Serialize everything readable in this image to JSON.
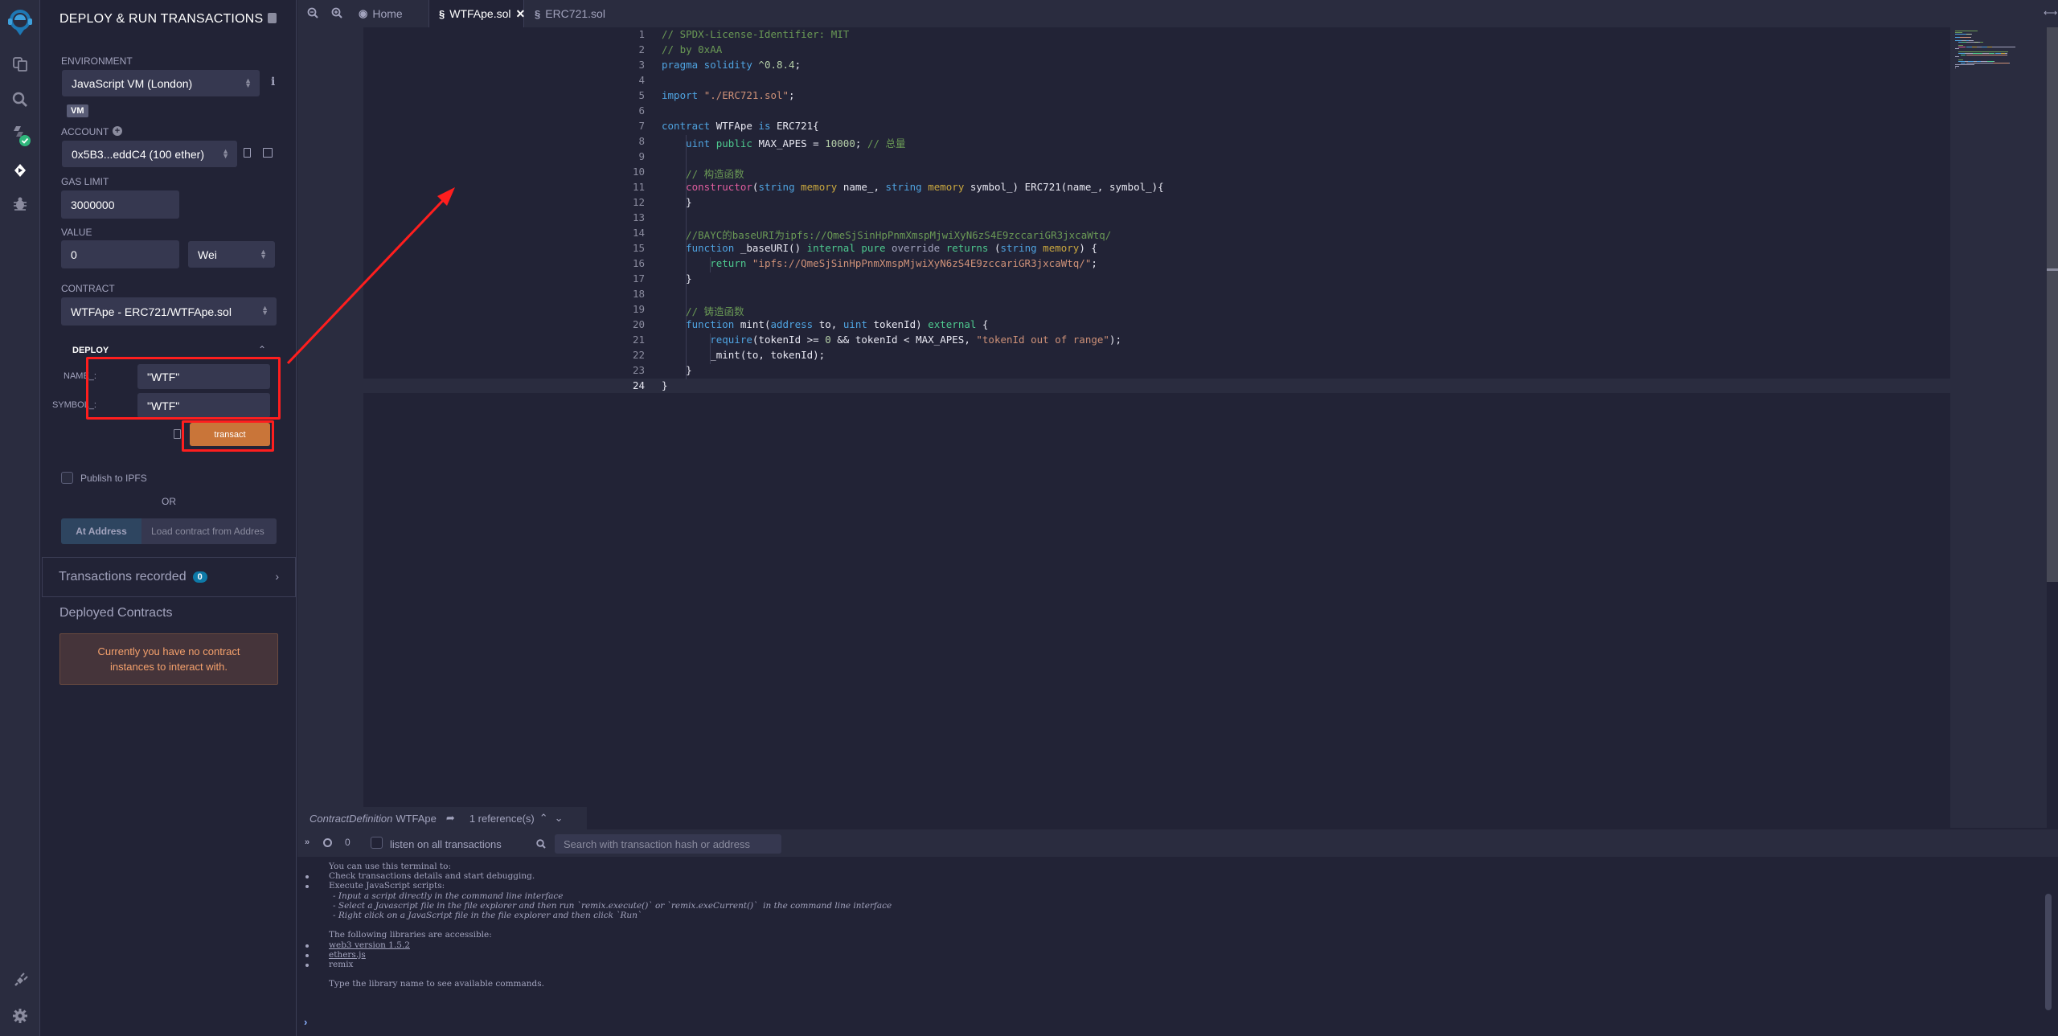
{
  "iconbar": {
    "items": [
      "remix-logo",
      "file-explorer",
      "search",
      "solidity-compiler",
      "deploy-run",
      "debugger"
    ],
    "bottom": [
      "plugin-manager",
      "settings"
    ]
  },
  "panel": {
    "title": "DEPLOY & RUN TRANSACTIONS",
    "environment_label": "ENVIRONMENT",
    "environment_value": "JavaScript VM (London)",
    "vm_badge": "VM",
    "account_label": "ACCOUNT",
    "account_value": "0x5B3...eddC4 (100 ether)",
    "gas_limit_label": "GAS LIMIT",
    "gas_limit_value": "3000000",
    "value_label": "VALUE",
    "value_value": "0",
    "value_unit": "Wei",
    "contract_label": "CONTRACT",
    "contract_value": "WTFApe - ERC721/WTFApe.sol",
    "deploy_label": "DEPLOY",
    "params": [
      {
        "label": "NAME_:",
        "value": "\"WTF\""
      },
      {
        "label": "SYMBOL_:",
        "value": "\"WTF\""
      }
    ],
    "transact_label": "transact",
    "publish_ipfs_label": "Publish to IPFS",
    "or_label": "OR",
    "at_address_label": "At Address",
    "load_contract_placeholder": "Load contract from Addres",
    "transactions_recorded_label": "Transactions recorded",
    "transactions_recorded_count": "0",
    "deployed_contracts_label": "Deployed Contracts",
    "no_contracts_message": "Currently you have no contract instances to interact with."
  },
  "editor": {
    "tabs": [
      {
        "label": "Home",
        "active": false
      },
      {
        "label": "WTFApe.sol",
        "active": true
      },
      {
        "label": "ERC721.sol",
        "active": false
      }
    ],
    "line_numbers": [
      "1",
      "2",
      "3",
      "4",
      "5",
      "6",
      "7",
      "8",
      "9",
      "10",
      "11",
      "12",
      "13",
      "14",
      "15",
      "16",
      "17",
      "18",
      "19",
      "20",
      "21",
      "22",
      "23",
      "24"
    ],
    "lines": [
      [
        [
          "c-cm",
          "// SPDX-License-Identifier: MIT"
        ]
      ],
      [
        [
          "c-cm",
          "// by 0xAA"
        ]
      ],
      [
        [
          "c-kw",
          "pragma solidity "
        ],
        [
          "c-nm",
          "^0.8.4"
        ],
        [
          "c-fn",
          ";"
        ]
      ],
      [],
      [
        [
          "c-kw",
          "import "
        ],
        [
          "c-st",
          "\"./ERC721.sol\""
        ],
        [
          "c-fn",
          ";"
        ]
      ],
      [],
      [
        [
          "c-kw",
          "contract "
        ],
        [
          "c-fn",
          "WTFApe "
        ],
        [
          "c-kw",
          "is "
        ],
        [
          "c-fn",
          "ERC721{"
        ]
      ],
      [
        [
          "c-fn",
          "    "
        ],
        [
          "c-ty",
          "uint "
        ],
        [
          "c-gr",
          "public "
        ],
        [
          "c-fn",
          "MAX_APES = "
        ],
        [
          "c-nm",
          "10000"
        ],
        [
          "c-fn",
          "; "
        ],
        [
          "c-cm",
          "// 总量"
        ]
      ],
      [],
      [
        [
          "c-fn",
          "    "
        ],
        [
          "c-cm",
          "// 构造函数"
        ]
      ],
      [
        [
          "c-fn",
          "    "
        ],
        [
          "c-ctor",
          "constructor"
        ],
        [
          "c-fn",
          "("
        ],
        [
          "c-ty",
          "string "
        ],
        [
          "c-mo",
          "memory "
        ],
        [
          "c-fn",
          "name_, "
        ],
        [
          "c-ty",
          "string "
        ],
        [
          "c-mo",
          "memory "
        ],
        [
          "c-fn",
          "symbol_) ERC721(name_, symbol_){"
        ]
      ],
      [
        [
          "c-fn",
          "    }"
        ]
      ],
      [],
      [
        [
          "c-fn",
          "    "
        ],
        [
          "c-cm",
          "//BAYC的baseURI为ipfs://QmeSjSinHpPnmXmspMjwiXyN6zS4E9zccariGR3jxcaWtq/"
        ]
      ],
      [
        [
          "c-fn",
          "    "
        ],
        [
          "c-ty",
          "function "
        ],
        [
          "c-fn",
          "_baseURI() "
        ],
        [
          "c-gr",
          "internal pure "
        ],
        [
          "c-ov",
          "override "
        ],
        [
          "c-gr",
          "returns "
        ],
        [
          "c-fn",
          "("
        ],
        [
          "c-ty",
          "string "
        ],
        [
          "c-mo",
          "memory"
        ],
        [
          "c-fn",
          ") {"
        ]
      ],
      [
        [
          "c-fn",
          "        "
        ],
        [
          "c-gr",
          "return "
        ],
        [
          "c-st",
          "\"ipfs://QmeSjSinHpPnmXmspMjwiXyN6zS4E9zccariGR3jxcaWtq/\""
        ],
        [
          "c-fn",
          ";"
        ]
      ],
      [
        [
          "c-fn",
          "    }"
        ]
      ],
      [],
      [
        [
          "c-fn",
          "    "
        ],
        [
          "c-cm",
          "// 铸造函数"
        ]
      ],
      [
        [
          "c-fn",
          "    "
        ],
        [
          "c-ty",
          "function "
        ],
        [
          "c-fn",
          "mint("
        ],
        [
          "c-ty",
          "address "
        ],
        [
          "c-fn",
          "to, "
        ],
        [
          "c-ty",
          "uint "
        ],
        [
          "c-fn",
          "tokenId) "
        ],
        [
          "c-gr",
          "external "
        ],
        [
          "c-fn",
          "{"
        ]
      ],
      [
        [
          "c-fn",
          "        "
        ],
        [
          "c-kw",
          "require"
        ],
        [
          "c-fn",
          "(tokenId >= "
        ],
        [
          "c-nm",
          "0"
        ],
        [
          "c-fn",
          " && tokenId < MAX_APES, "
        ],
        [
          "c-st",
          "\"tokenId out of range\""
        ],
        [
          "c-fn",
          ");"
        ]
      ],
      [
        [
          "c-fn",
          "        _mint(to, tokenId);"
        ]
      ],
      [
        [
          "c-fn",
          "    }"
        ]
      ],
      [
        [
          "c-fn",
          "}"
        ]
      ]
    ]
  },
  "reference_bar": {
    "kind": "ContractDefinition",
    "name": "WTFApe",
    "references": "1 reference(s)"
  },
  "terminal": {
    "pending_count": "0",
    "listen_label": "listen on all transactions",
    "search_placeholder": "Search with transaction hash or address",
    "lines": [
      {
        "text": "You can use this terminal to:",
        "indent": 0,
        "bullet": false,
        "style": ""
      },
      {
        "text": "Check transactions details and start debugging.",
        "indent": 0,
        "bullet": true,
        "style": ""
      },
      {
        "text": "Execute JavaScript scripts:",
        "indent": 0,
        "bullet": true,
        "style": ""
      },
      {
        "text": "- Input a script directly in the command line interface",
        "indent": 1,
        "bullet": false,
        "style": "it"
      },
      {
        "text": "- Select a Javascript file in the file explorer and then run `remix.execute()` or `remix.exeCurrent()`  in the command line interface",
        "indent": 1,
        "bullet": false,
        "style": "it"
      },
      {
        "text": "- Right click on a JavaScript file in the file explorer and then click `Run`",
        "indent": 1,
        "bullet": false,
        "style": "it"
      },
      {
        "text": "",
        "indent": 0,
        "bullet": false,
        "style": ""
      },
      {
        "text": "The following libraries are accessible:",
        "indent": 0,
        "bullet": false,
        "style": ""
      },
      {
        "text": "web3 version 1.5.2",
        "indent": 0,
        "bullet": true,
        "style": "u"
      },
      {
        "text": "ethers.js",
        "indent": 0,
        "bullet": true,
        "style": "u"
      },
      {
        "text": "remix",
        "indent": 0,
        "bullet": true,
        "style": ""
      },
      {
        "text": "",
        "indent": 0,
        "bullet": false,
        "style": ""
      },
      {
        "text": "Type the library name to see available commands.",
        "indent": 0,
        "bullet": false,
        "style": ""
      }
    ]
  },
  "colors": {
    "accent_transact": "#c97539",
    "annotation_red": "#ff1e1e",
    "badge_blue": "#0e79a7"
  }
}
